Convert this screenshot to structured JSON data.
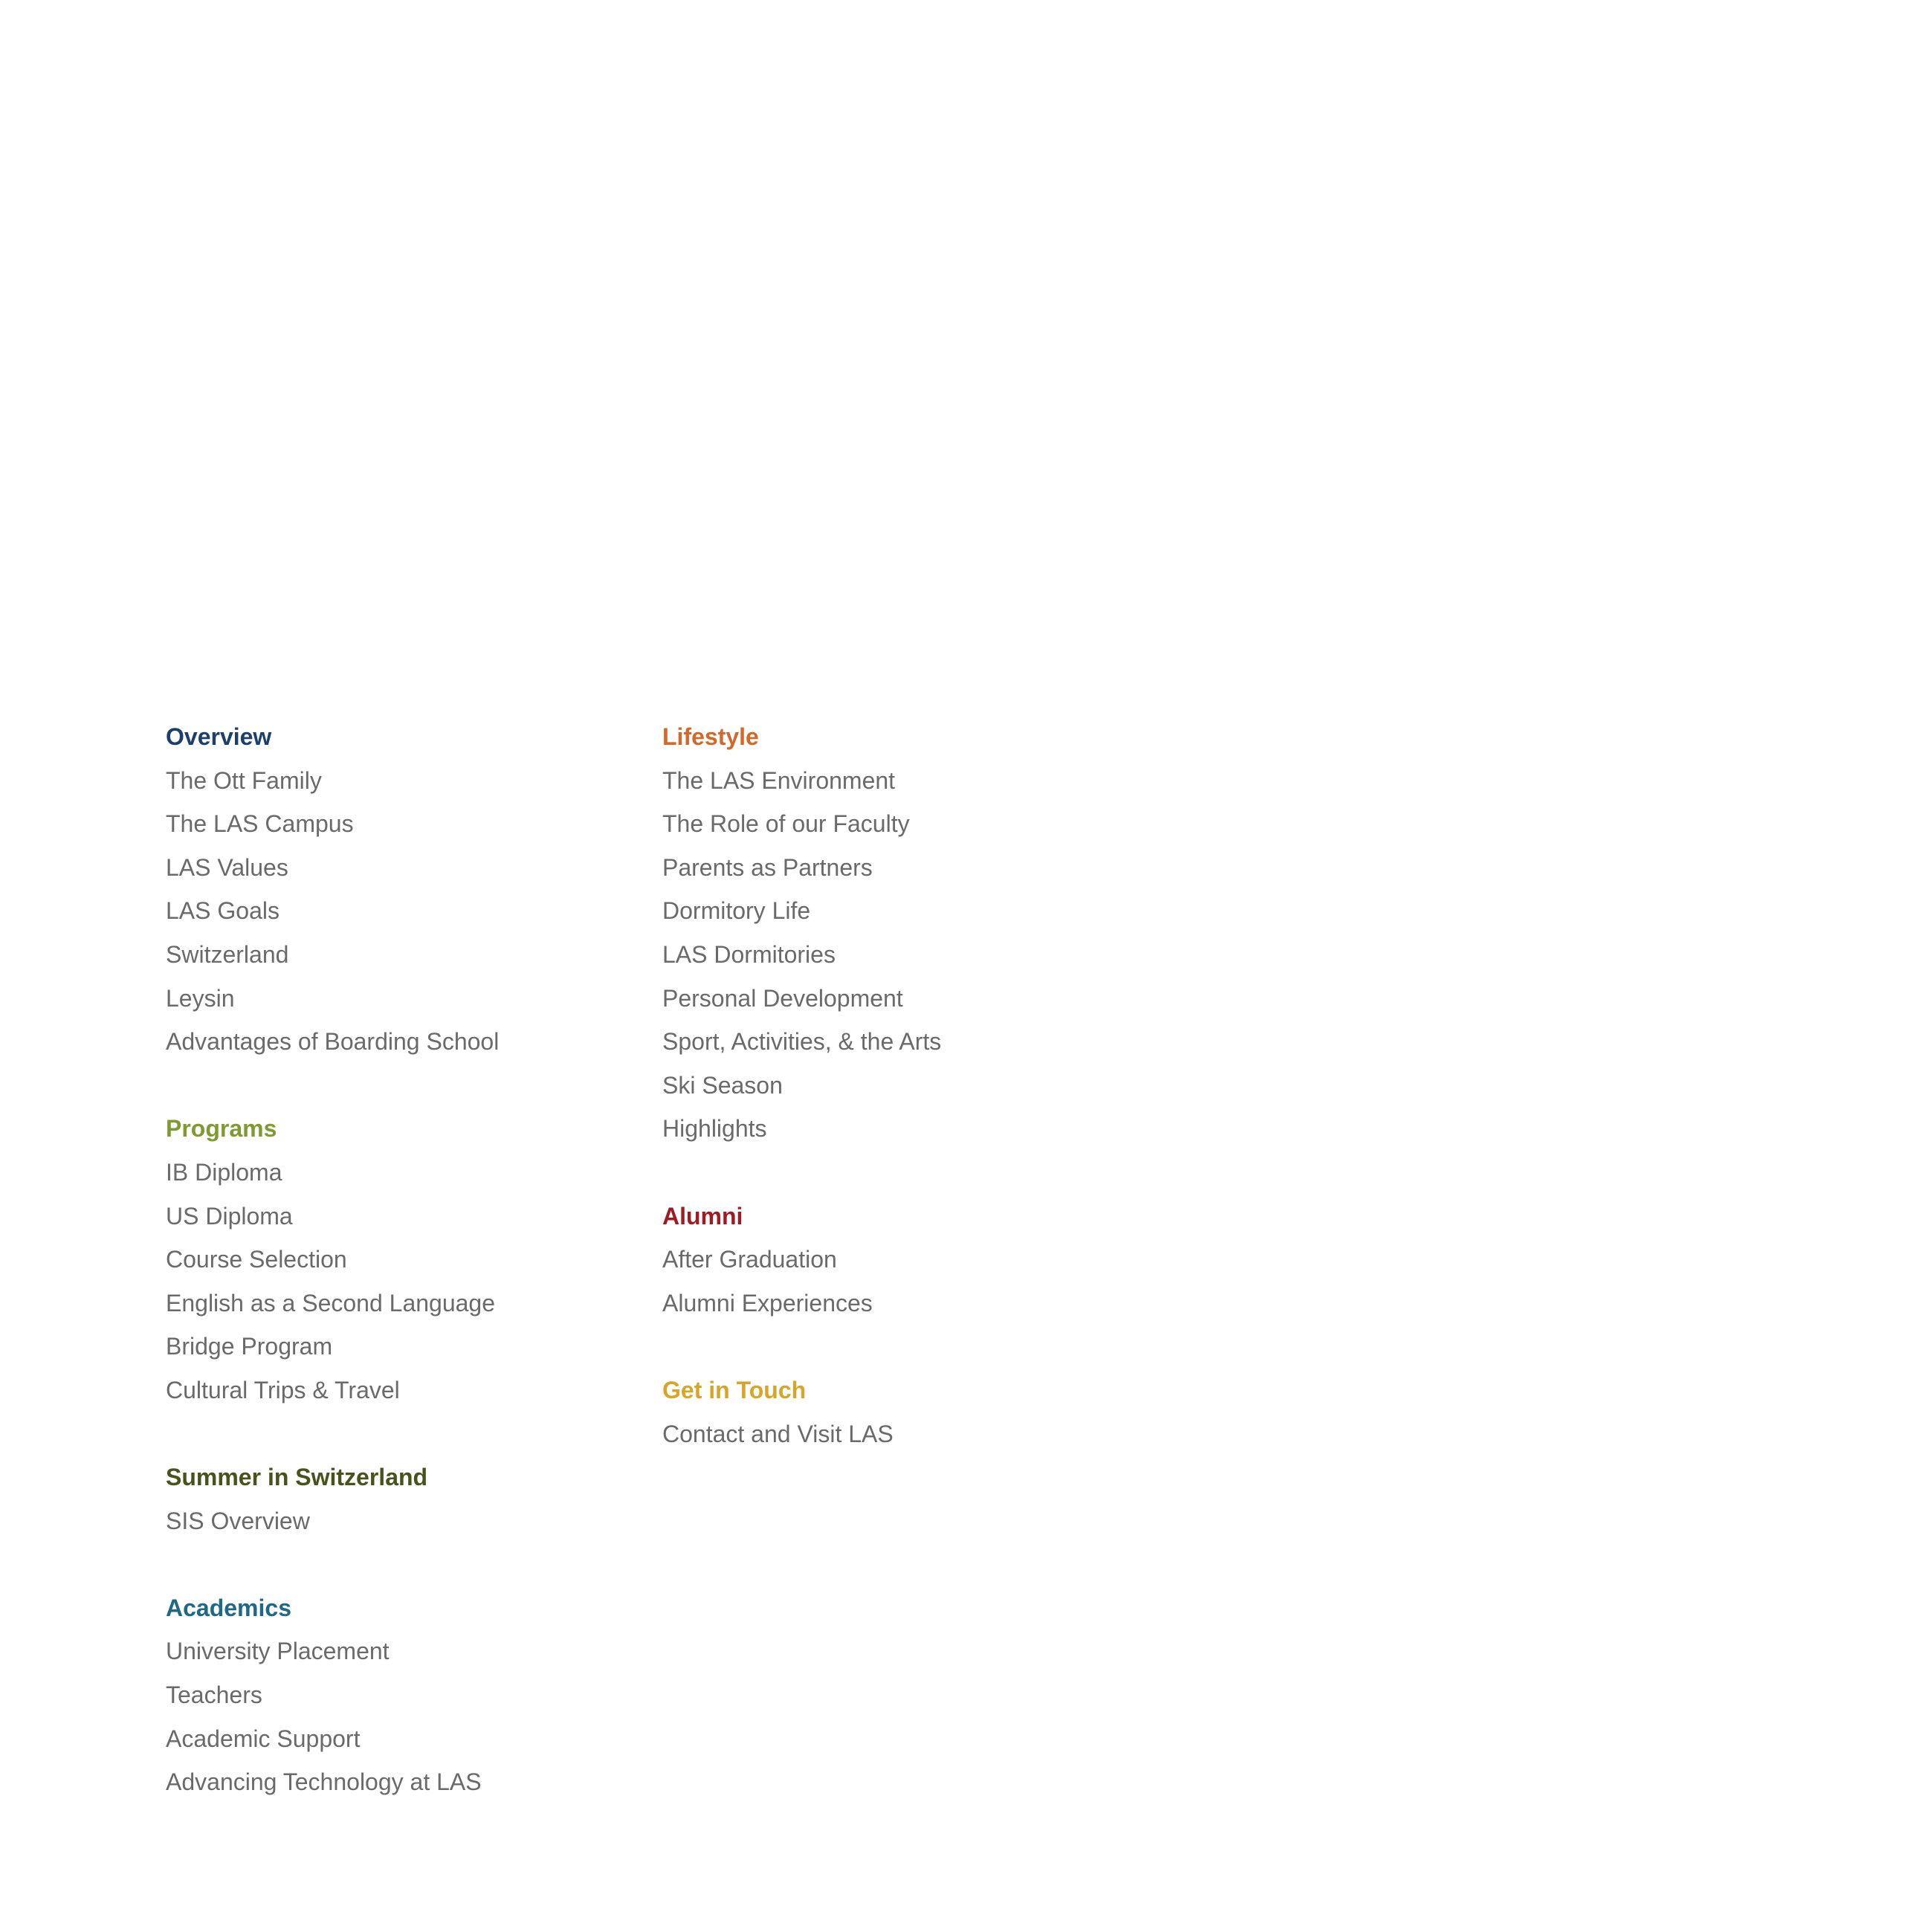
{
  "toc": {
    "overview": {
      "heading": "Overview",
      "color": "#1d3f6e",
      "items": [
        "The Ott Family",
        "The LAS Campus",
        "LAS Values",
        "LAS Goals",
        "Switzerland",
        "Leysin",
        "Advantages of Boarding School"
      ]
    },
    "programs": {
      "heading": "Programs",
      "color": "#7f9a31",
      "items": [
        "IB Diploma",
        "US Diploma",
        "Course Selection",
        "English as a Second Language",
        "Bridge Program",
        "Cultural Trips & Travel"
      ]
    },
    "summer": {
      "heading": "Summer in Switzerland",
      "color": "#48521d",
      "items": [
        "SIS Overview"
      ]
    },
    "academics": {
      "heading": "Academics",
      "color": "#1f6987",
      "items": [
        "University Placement",
        "Teachers",
        "Academic Support",
        "Advancing Technology at LAS"
      ]
    },
    "lifestyle": {
      "heading": "Lifestyle",
      "color": "#d2692a",
      "items": [
        "The LAS Environment",
        "The Role of our Faculty",
        "Parents as Partners",
        "Dormitory Life",
        "LAS Dormitories",
        "Personal Development",
        "Sport, Activities, & the Arts",
        "Ski Season",
        "Highlights"
      ]
    },
    "alumni": {
      "heading": "Alumni",
      "color": "#9e1c22",
      "items": [
        "After Graduation",
        "Alumni Experiences"
      ]
    },
    "contact": {
      "heading": "Get in Touch",
      "color": "#d5a62a",
      "items": [
        "Contact and Visit LAS"
      ]
    }
  }
}
